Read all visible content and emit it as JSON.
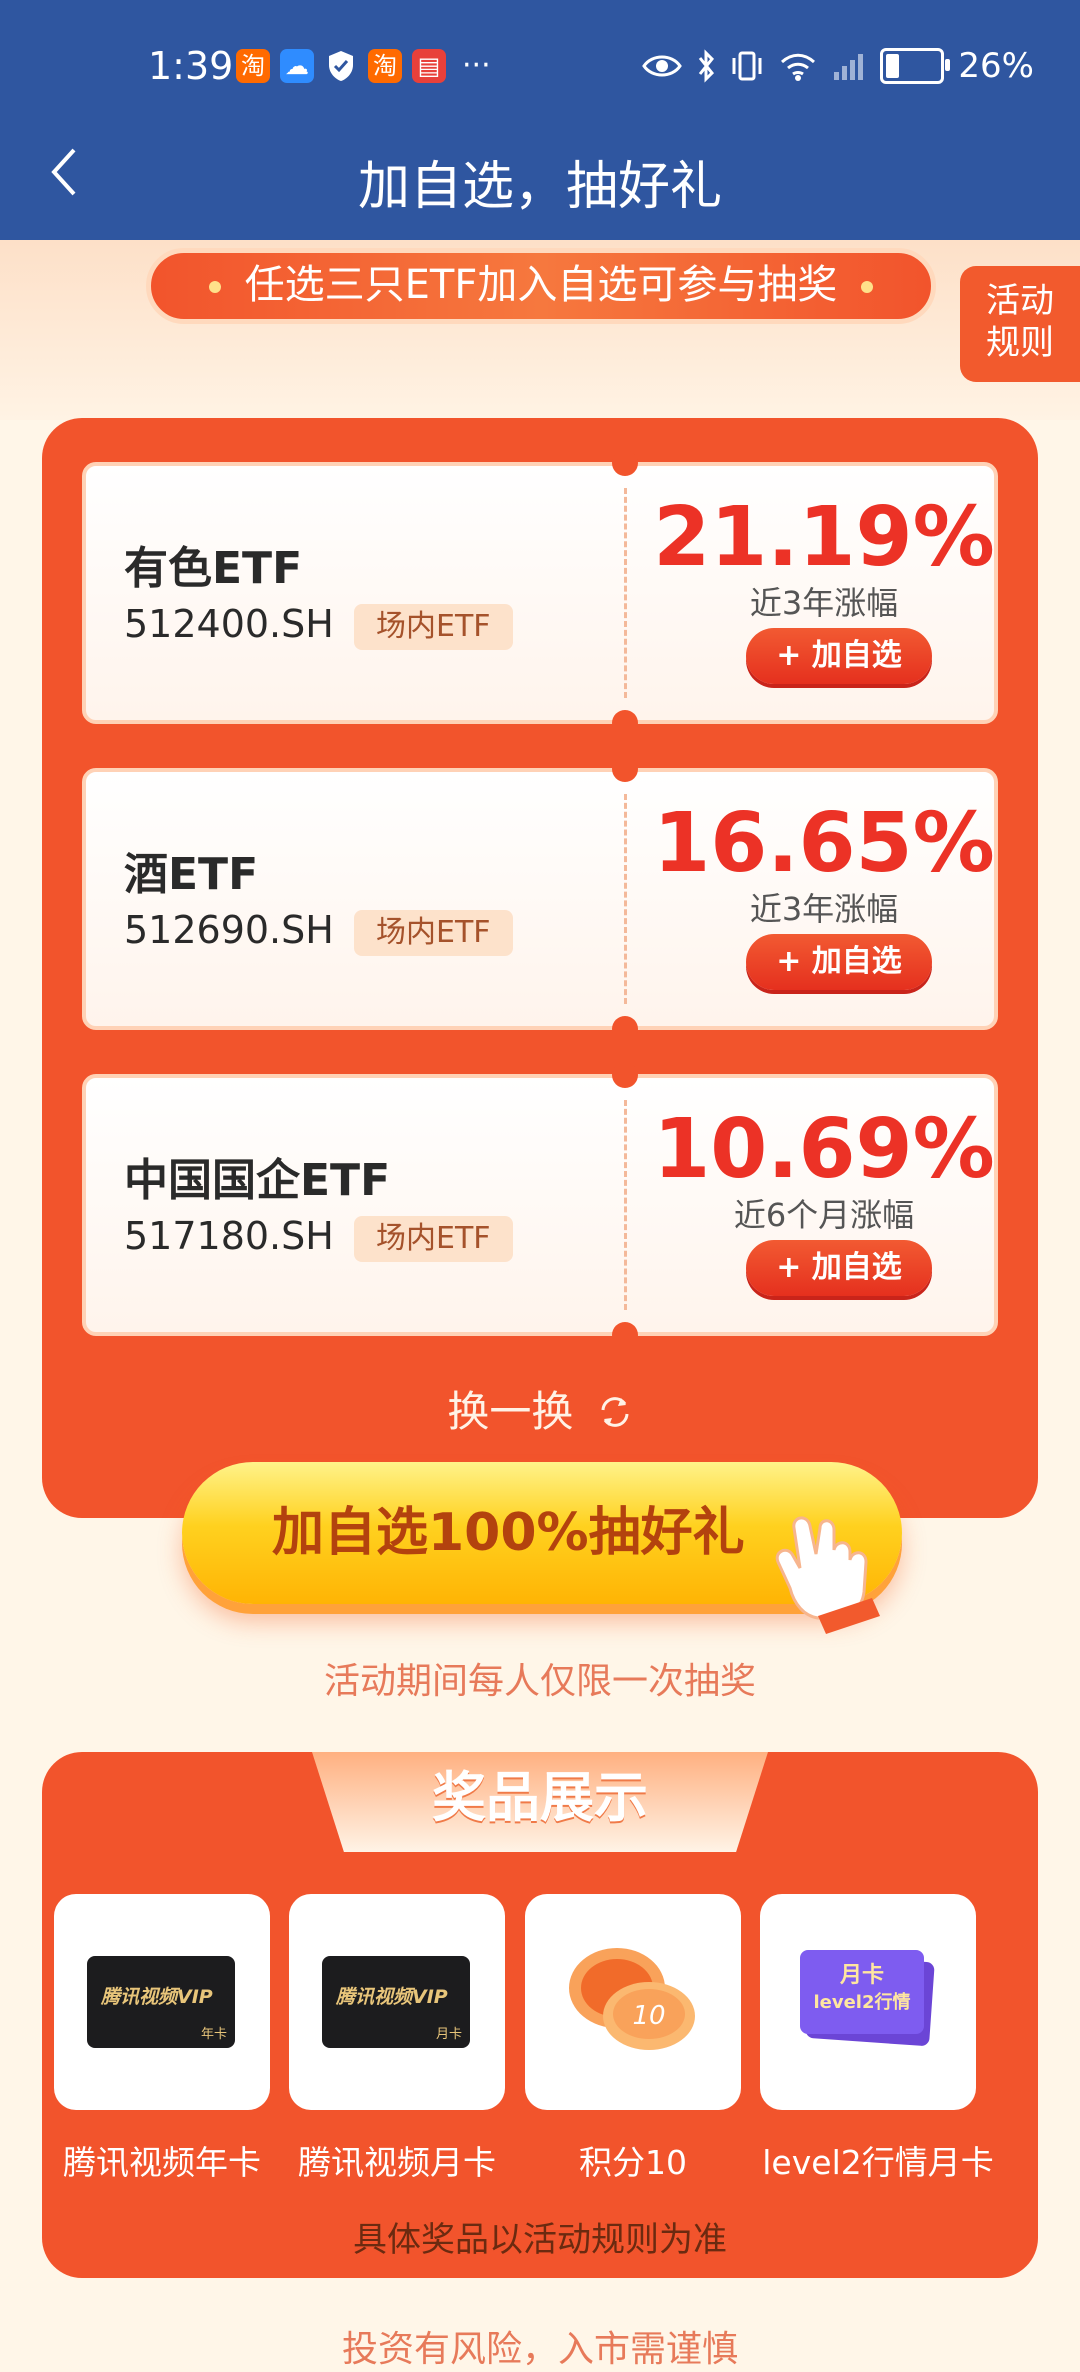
{
  "status_bar": {
    "time": "1:39",
    "notification_icons": [
      "taobao-icon",
      "cloud-icon",
      "shield-icon",
      "taobao-icon",
      "book-icon"
    ],
    "more": "···",
    "battery": "26%"
  },
  "nav": {
    "title": "加自选，抽好礼"
  },
  "hero": {
    "banner": "任选三只ETF加入自选可参与抽奖",
    "rules_button": "活动规则"
  },
  "etfs": [
    {
      "name": "有色ETF",
      "code": "512400.SH",
      "tag": "场内ETF",
      "return": "21.19%",
      "period": "近3年涨幅",
      "button": "+ 加自选"
    },
    {
      "name": "酒ETF",
      "code": "512690.SH",
      "tag": "场内ETF",
      "return": "16.65%",
      "period": "近3年涨幅",
      "button": "+ 加自选"
    },
    {
      "name": "中国国企ETF",
      "code": "517180.SH",
      "tag": "场内ETF",
      "return": "10.69%",
      "period": "近6个月涨幅",
      "button": "+ 加自选"
    }
  ],
  "swap_label": "换一换",
  "cta": {
    "label": "加自选100%抽好礼"
  },
  "limit_note": "活动期间每人仅限一次抽奖",
  "prizes": {
    "title": "奖品展示",
    "items": [
      {
        "label": "腾讯视频年卡",
        "card_text": "腾讯视频VIP",
        "card_sub": "年卡"
      },
      {
        "label": "腾讯视频月卡",
        "card_text": "腾讯视频VIP",
        "card_sub": "月卡"
      },
      {
        "label": "积分10",
        "coin_value": "10"
      },
      {
        "label": "level2行情月卡",
        "card_line1": "月卡",
        "card_line2": "level2行情"
      }
    ],
    "note": "具体奖品以活动规则为准"
  },
  "footer_partial": "投资有风险，入市需谨慎",
  "colors": {
    "nav_bg": "#2f56a0",
    "primary": "#f2542c",
    "accent_red": "#ec3226",
    "cta_yellow": "#ffd11f"
  }
}
